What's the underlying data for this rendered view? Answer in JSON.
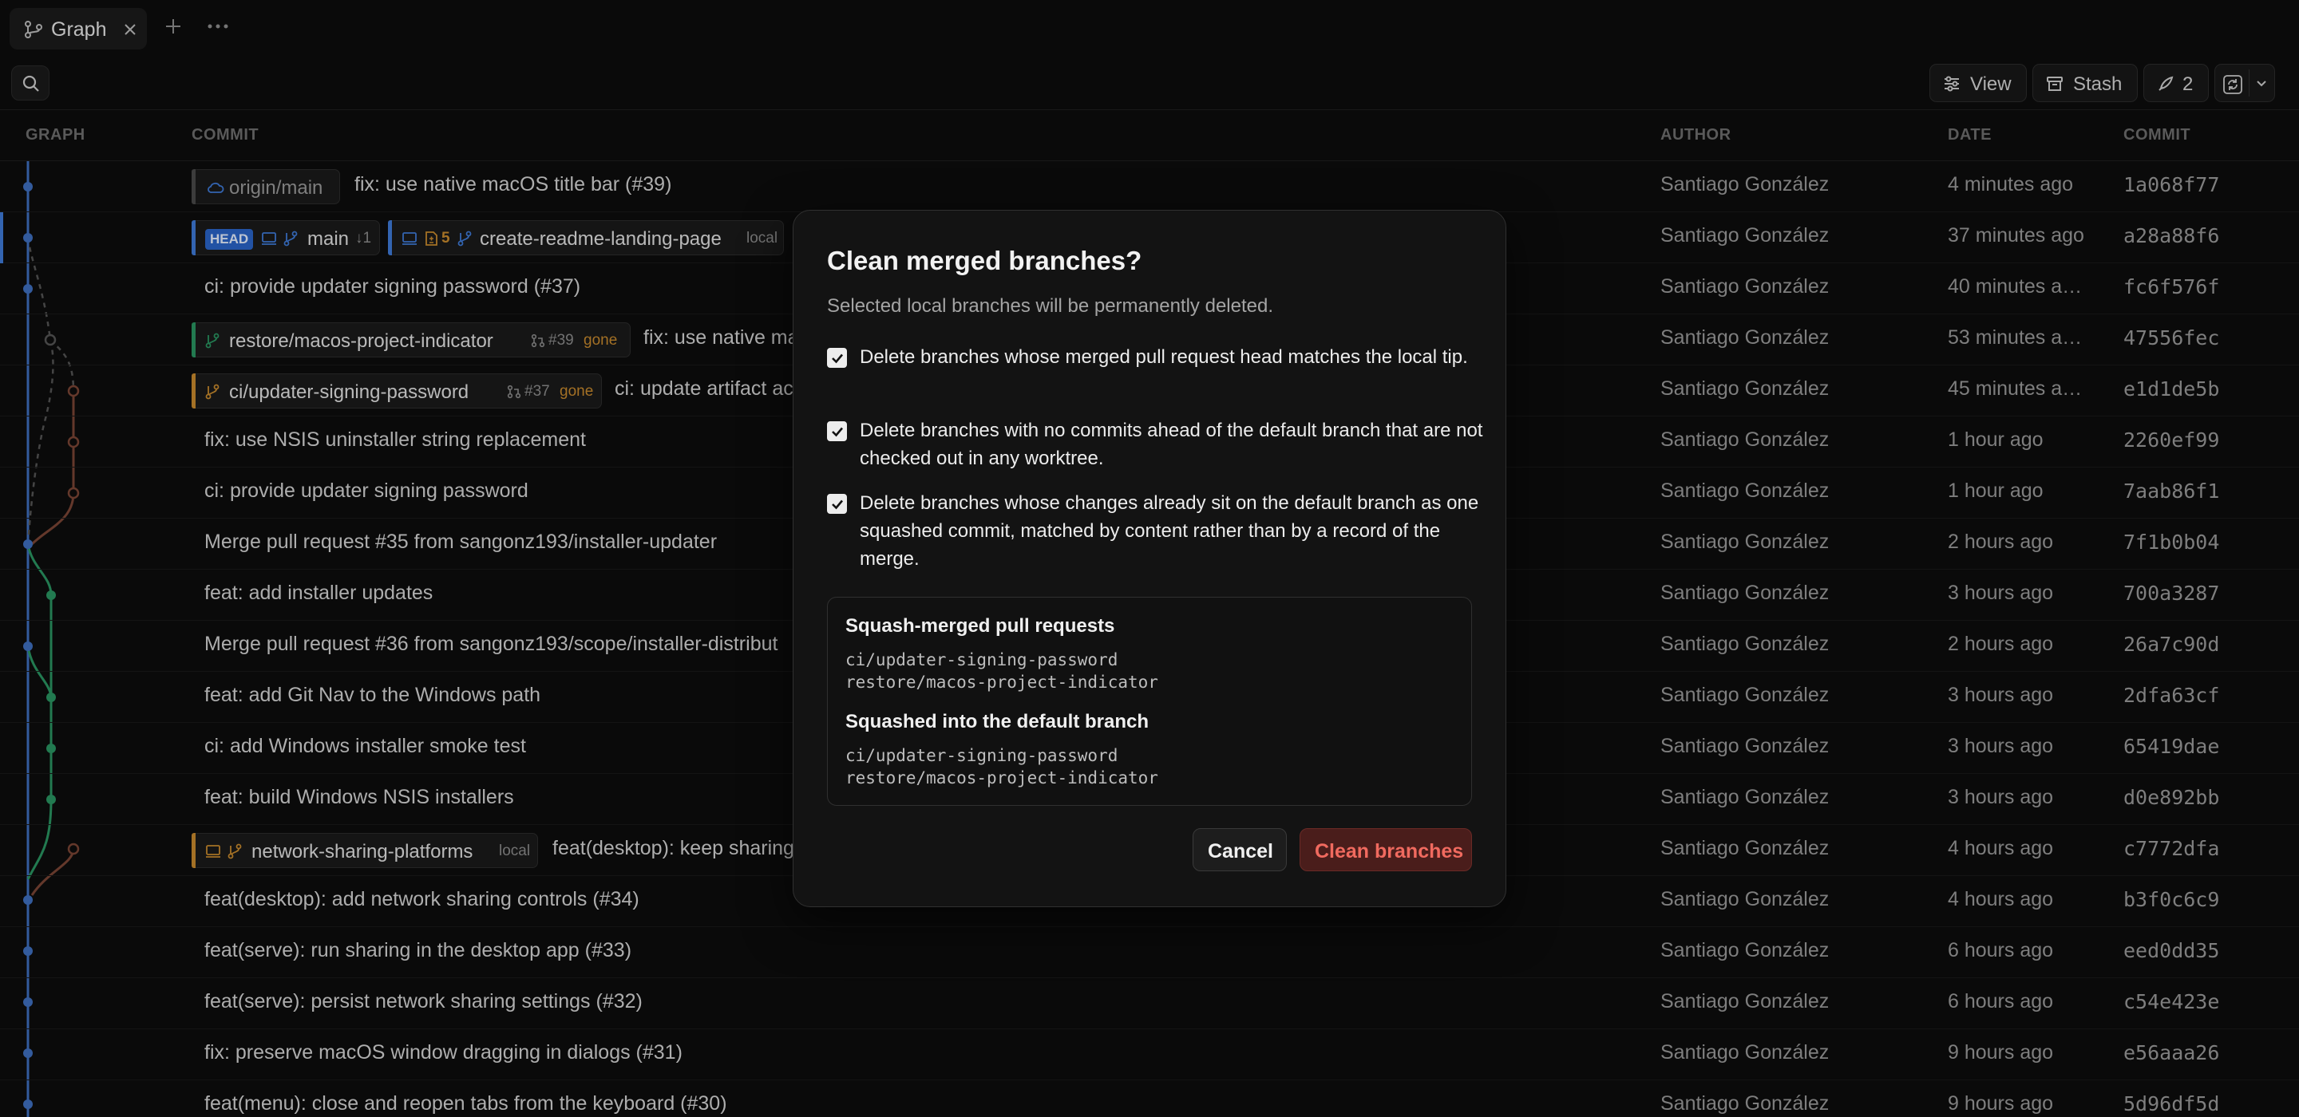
{
  "tabbar": {
    "tabs": [
      {
        "label": "Graph",
        "icon": "git-graph-icon"
      }
    ],
    "add_icon": "plus-icon",
    "more_icon": "more-horizontal-icon"
  },
  "toolbar": {
    "search_icon": "search-icon",
    "view_label": "View",
    "stash_label": "Stash",
    "agent_count": "2"
  },
  "table": {
    "headers": {
      "graph": "GRAPH",
      "commit": "COMMIT",
      "author": "AUTHOR",
      "date": "DATE",
      "sha": "COMMIT"
    },
    "rows": [
      {
        "refs": [
          {
            "label": "origin/main",
            "kind": "remote"
          }
        ],
        "message": "fix: use native macOS title bar (#39)",
        "author": "Santiago González",
        "date": "4 minutes ago",
        "sha": "1a068f77"
      },
      {
        "refs": [
          {
            "label": "HEAD"
          },
          {
            "label": "main",
            "extra": "↓1"
          },
          {
            "label": "5",
            "kind": "pr"
          },
          {
            "label": "create-readme-landing-page",
            "extra": "local"
          }
        ],
        "message": "",
        "author": "Santiago González",
        "date": "37 minutes ago",
        "sha": "a28a88f6"
      },
      {
        "refs": [],
        "message": "ci: provide updater signing password (#37)",
        "author": "Santiago González",
        "date": "40 minutes a…",
        "sha": "fc6f576f"
      },
      {
        "refs": [
          {
            "label": "restore/macos-project-indicator",
            "extra": "#39",
            "status": "gone"
          }
        ],
        "message": "fix: use native ma",
        "author": "Santiago González",
        "date": "53 minutes a…",
        "sha": "47556fec"
      },
      {
        "refs": [
          {
            "label": "ci/updater-signing-password",
            "extra": "#37",
            "status": "gone"
          }
        ],
        "message": "ci: update artifact ac",
        "author": "Santiago González",
        "date": "45 minutes a…",
        "sha": "e1d1de5b"
      },
      {
        "refs": [],
        "message": "fix: use NSIS uninstaller string replacement",
        "author": "Santiago González",
        "date": "1 hour ago",
        "sha": "2260ef99"
      },
      {
        "refs": [],
        "message": "ci: provide updater signing password",
        "author": "Santiago González",
        "date": "1 hour ago",
        "sha": "7aab86f1"
      },
      {
        "refs": [],
        "message": "Merge pull request #35 from sangonz193/installer-updater",
        "author": "Santiago González",
        "date": "2 hours ago",
        "sha": "7f1b0b04"
      },
      {
        "refs": [],
        "message": "feat: add installer updates",
        "author": "Santiago González",
        "date": "3 hours ago",
        "sha": "700a3287"
      },
      {
        "refs": [],
        "message": "Merge pull request #36 from sangonz193/scope/installer-distribut",
        "author": "Santiago González",
        "date": "2 hours ago",
        "sha": "26a7c90d"
      },
      {
        "refs": [],
        "message": "feat: add Git Nav to the Windows path",
        "author": "Santiago González",
        "date": "3 hours ago",
        "sha": "2dfa63cf"
      },
      {
        "refs": [],
        "message": "ci: add Windows installer smoke test",
        "author": "Santiago González",
        "date": "3 hours ago",
        "sha": "65419dae"
      },
      {
        "refs": [],
        "message": "feat: build Windows NSIS installers",
        "author": "Santiago González",
        "date": "3 hours ago",
        "sha": "d0e892bb"
      },
      {
        "refs": [
          {
            "label": "network-sharing-platforms",
            "extra": "local"
          }
        ],
        "message": "feat(desktop): keep sharing",
        "author": "Santiago González",
        "date": "4 hours ago",
        "sha": "c7772dfa"
      },
      {
        "refs": [],
        "message": "feat(desktop): add network sharing controls (#34)",
        "author": "Santiago González",
        "date": "4 hours ago",
        "sha": "b3f0c6c9"
      },
      {
        "refs": [],
        "message": "feat(serve): run sharing in the desktop app (#33)",
        "author": "Santiago González",
        "date": "6 hours ago",
        "sha": "eed0dd35"
      },
      {
        "refs": [],
        "message": "feat(serve): persist network sharing settings (#32)",
        "author": "Santiago González",
        "date": "6 hours ago",
        "sha": "c54e423e"
      },
      {
        "refs": [],
        "message": "fix: preserve macOS window dragging in dialogs (#31)",
        "author": "Santiago González",
        "date": "9 hours ago",
        "sha": "e56aaa26"
      },
      {
        "refs": [],
        "message": "feat(menu): close and reopen tabs from the keyboard (#30)",
        "author": "Santiago González",
        "date": "9 hours ago",
        "sha": "5d96df5d"
      }
    ]
  },
  "modal": {
    "title": "Clean merged branches?",
    "subtitle": "Selected local branches will be permanently deleted.",
    "options": [
      {
        "checked": true,
        "text": "Delete branches whose merged pull request head matches the local tip."
      },
      {
        "checked": true,
        "text": "Delete branches with no commits ahead of the default branch that are not checked out in any worktree."
      },
      {
        "checked": true,
        "text": "Delete branches whose changes already sit on the default branch as one squashed commit, matched by content rather than by a record of the merge."
      }
    ],
    "sections": [
      {
        "heading": "Squash-merged pull requests",
        "branches": [
          "ci/updater-signing-password",
          "restore/macos-project-indicator"
        ]
      },
      {
        "heading": "Squashed into the default branch",
        "branches": [
          "ci/updater-signing-password",
          "restore/macos-project-indicator"
        ]
      }
    ],
    "cancel_label": "Cancel",
    "confirm_label": "Clean branches"
  },
  "colors": {
    "accent_blue": "#3f7bd8",
    "branch_green": "#2fa36b",
    "branch_brown": "#8a4a3a",
    "branch_orange": "#c98a2e",
    "danger": "#f06a5f"
  }
}
